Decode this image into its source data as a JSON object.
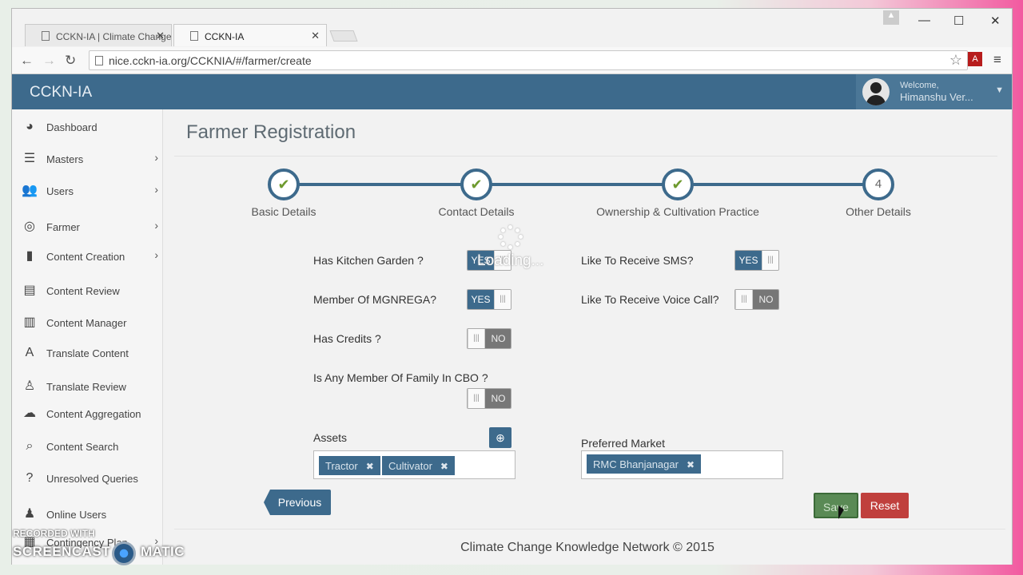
{
  "browser": {
    "tabs": [
      {
        "title": "CCKN-IA | Climate Change"
      },
      {
        "title": "CCKN-IA"
      }
    ],
    "url": "nice.cckn-ia.org/CCKNIA/#/farmer/create"
  },
  "app": {
    "brand": "CCKN-IA",
    "welcome": "Welcome,",
    "user_name": "Himanshu Ver..."
  },
  "sidebar": {
    "items": [
      {
        "label": "Dashboard",
        "icon": "dashboard-icon"
      },
      {
        "label": "Masters",
        "icon": "list-icon"
      },
      {
        "label": "Users",
        "icon": "users-icon"
      },
      {
        "label": "Farmer",
        "icon": "farmer-icon"
      },
      {
        "label": "Content Creation",
        "icon": "book-icon"
      },
      {
        "label": "Content Review",
        "icon": "review-icon"
      },
      {
        "label": "Content Manager",
        "icon": "manager-icon"
      },
      {
        "label": "Translate Content",
        "icon": "translate-icon"
      },
      {
        "label": "Translate Review",
        "icon": "translate-review-icon"
      },
      {
        "label": "Content Aggregation",
        "icon": "cloud-icon"
      },
      {
        "label": "Content Search",
        "icon": "search-icon"
      },
      {
        "label": "Unresolved Queries",
        "icon": "question-icon"
      },
      {
        "label": "Online Users",
        "icon": "online-user-icon"
      },
      {
        "label": "Contingency Plan",
        "icon": "plan-icon"
      }
    ]
  },
  "page": {
    "title": "Farmer Registration",
    "steps": [
      {
        "label": "Basic Details",
        "done": true
      },
      {
        "label": "Contact Details",
        "done": true
      },
      {
        "label": "Ownership & Cultivation Practice",
        "done": true
      },
      {
        "label": "Other Details",
        "done": false,
        "number": "4"
      }
    ],
    "loading_text": "Loading...",
    "fields": {
      "kitchen_garden": {
        "label": "Has Kitchen Garden ?",
        "value": "YES"
      },
      "mgnrega": {
        "label": "Member Of MGNREGA?",
        "value": "YES"
      },
      "credits": {
        "label": "Has Credits ?",
        "value": "NO"
      },
      "cbo": {
        "label": "Is Any Member Of Family In CBO ?",
        "value": "NO"
      },
      "sms": {
        "label": "Like To Receive SMS?",
        "value": "YES"
      },
      "voice": {
        "label": "Like To Receive Voice Call?",
        "value": "NO"
      }
    },
    "assets": {
      "label": "Assets",
      "tags": [
        "Tractor",
        "Cultivator"
      ]
    },
    "market": {
      "label": "Preferred Market",
      "tags": [
        "RMC Bhanjanagar"
      ]
    },
    "buttons": {
      "previous": "Previous",
      "save": "Save",
      "reset": "Reset"
    },
    "footer": "Climate Change Knowledge Network © 2015"
  },
  "watermark": {
    "line1": "RECORDED WITH",
    "line2": "SCREENCAST",
    "line3": "MATIC"
  }
}
